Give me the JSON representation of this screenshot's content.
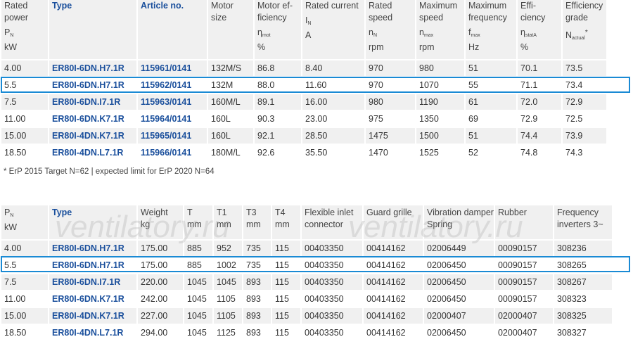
{
  "table1": {
    "headers": [
      {
        "l1": "Rated",
        "l2": "power",
        "sym": "P",
        "sub": "N",
        "unit": "kW"
      },
      {
        "l1": "Type",
        "l2": "",
        "sym": "",
        "sub": "",
        "unit": ""
      },
      {
        "l1": "Article no.",
        "l2": "",
        "sym": "",
        "sub": "",
        "unit": ""
      },
      {
        "l1": "Motor",
        "l2": "size",
        "sym": "",
        "sub": "",
        "unit": ""
      },
      {
        "l1": "Motor ef-",
        "l2": "ficiency",
        "sym": "η",
        "sub": "mot",
        "unit": "%"
      },
      {
        "l1": "Rated current",
        "l2": "",
        "sym": "I",
        "sub": "N",
        "unit": "A"
      },
      {
        "l1": "Rated",
        "l2": "speed",
        "sym": "n",
        "sub": "N",
        "unit": "rpm"
      },
      {
        "l1": "Maximum",
        "l2": "speed",
        "sym": "n",
        "sub": "max",
        "unit": "rpm"
      },
      {
        "l1": "Maximum",
        "l2": "frequency",
        "sym": "f",
        "sub": "max",
        "unit": "Hz"
      },
      {
        "l1": "Effi-",
        "l2": "ciency",
        "sym": "η",
        "sub": "statA",
        "unit": "%"
      },
      {
        "l1": "Efficiency",
        "l2": "grade",
        "sym": "N",
        "sub": "actual",
        "sup": "*",
        "unit": ""
      }
    ],
    "rows": [
      [
        "4.00",
        "ER80I-6DN.H7.1R",
        "115961/0141",
        "132M/S",
        "86.8",
        "8.40",
        "970",
        "980",
        "51",
        "70.1",
        "73.5"
      ],
      [
        "5.5",
        "ER80I-6DN.H7.1R",
        "115962/0141",
        "132M",
        "88.0",
        "11.60",
        "970",
        "1070",
        "55",
        "71.1",
        "73.4"
      ],
      [
        "7.5",
        "ER80I-6DN.I7.1R",
        "115963/0141",
        "160M/L",
        "89.1",
        "16.00",
        "980",
        "1190",
        "61",
        "72.0",
        "72.9"
      ],
      [
        "11.00",
        "ER80I-6DN.K7.1R",
        "115964/0141",
        "160L",
        "90.3",
        "23.00",
        "975",
        "1350",
        "69",
        "72.9",
        "72.5"
      ],
      [
        "15.00",
        "ER80I-4DN.K7.1R",
        "115965/0141",
        "160L",
        "92.1",
        "28.50",
        "1475",
        "1500",
        "51",
        "74.4",
        "73.9"
      ],
      [
        "18.50",
        "ER80I-4DN.L7.1R",
        "115966/0141",
        "180M/L",
        "92.6",
        "35.50",
        "1470",
        "1525",
        "52",
        "74.8",
        "74.3"
      ]
    ]
  },
  "note": "* ErP 2015 Target N=62 | expected limit for ErP 2020 N=64",
  "table2": {
    "headers": [
      {
        "l1": "P",
        "sub": "N",
        "l2": "kW"
      },
      {
        "l1": "Type",
        "l2": ""
      },
      {
        "l1": "Weight",
        "l2": "kg"
      },
      {
        "l1": "T",
        "l2": "mm"
      },
      {
        "l1": "T1",
        "l2": "mm"
      },
      {
        "l1": "T3",
        "l2": "mm"
      },
      {
        "l1": "T4",
        "l2": "mm"
      },
      {
        "l1": "Flexible inlet",
        "l2": "connector"
      },
      {
        "l1": "Guard grille",
        "l2": ""
      },
      {
        "l1": "Vibration damper",
        "l2": "Spring"
      },
      {
        "l1": "",
        "l2": "Rubber"
      },
      {
        "l1": "Frequency",
        "l2": "inverters 3~"
      }
    ],
    "rows": [
      [
        "4.00",
        "ER80I-6DN.H7.1R",
        "175.00",
        "885",
        "952",
        "735",
        "115",
        "00403350",
        "00414162",
        "02006449",
        "00090157",
        "308236"
      ],
      [
        "5.5",
        "ER80I-6DN.H7.1R",
        "175.00",
        "885",
        "1002",
        "735",
        "115",
        "00403350",
        "00414162",
        "02006450",
        "00090157",
        "308265"
      ],
      [
        "7.5",
        "ER80I-6DN.I7.1R",
        "220.00",
        "1045",
        "1045",
        "893",
        "115",
        "00403350",
        "00414162",
        "02006450",
        "00090157",
        "308267"
      ],
      [
        "11.00",
        "ER80I-6DN.K7.1R",
        "242.00",
        "1045",
        "1105",
        "893",
        "115",
        "00403350",
        "00414162",
        "02006450",
        "00090157",
        "308323"
      ],
      [
        "15.00",
        "ER80I-4DN.K7.1R",
        "227.00",
        "1045",
        "1105",
        "893",
        "115",
        "00403350",
        "00414162",
        "02000407",
        "02000407",
        "308325"
      ],
      [
        "18.50",
        "ER80I-4DN.L7.1R",
        "294.00",
        "1045",
        "1125",
        "893",
        "115",
        "00403350",
        "00414162",
        "02006450",
        "02000407",
        "308327"
      ]
    ]
  },
  "watermark": "ventilatory.ru"
}
